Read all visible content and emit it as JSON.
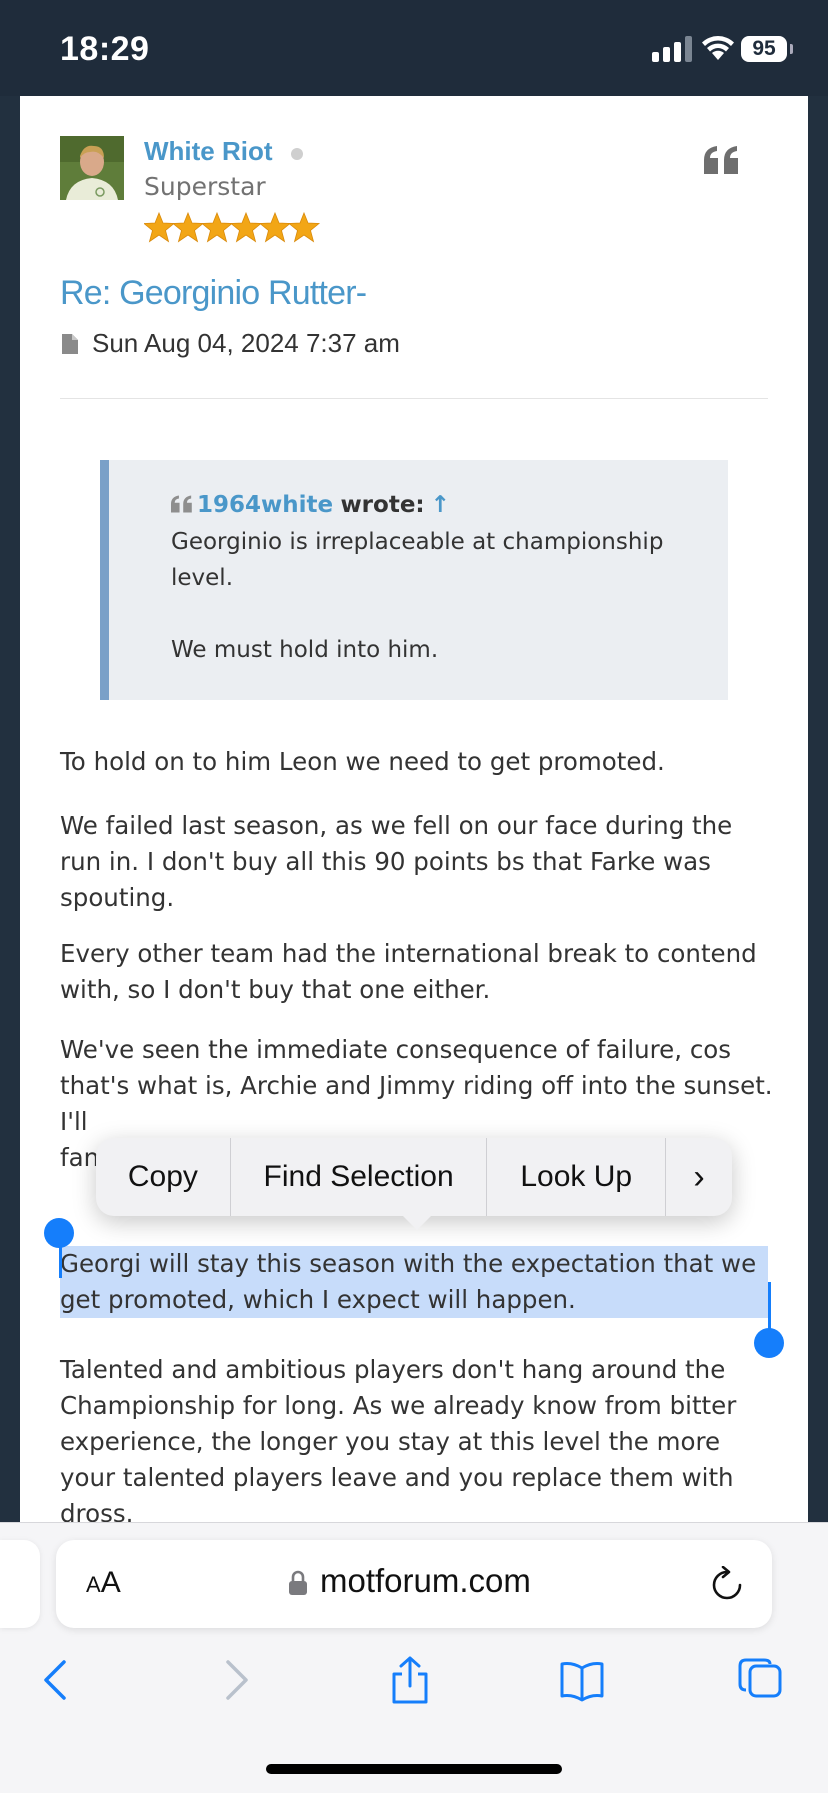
{
  "status_bar": {
    "time": "18:29",
    "battery": "95"
  },
  "post": {
    "author": "White Riot",
    "rank": "Superstar",
    "star_count": 6,
    "title": "Re: Georginio Rutter-",
    "date": "Sun Aug 04, 2024 7:37 am",
    "quote": {
      "author": "1964white",
      "wrote_label": "wrote:",
      "arrow": "↑",
      "line1": "Georginio is irreplaceable at championship level.",
      "line2": "We must hold into him."
    },
    "paragraphs": [
      "To hold on to him Leon we need to get promoted.",
      "We failed last season, as we fell on our face during the run in. I don't buy all this 90 points bs that Farke was spouting.",
      "Every other team had the international break to contend with, so I don't buy that one either.",
      "We've seen the immediate consequence of failure, cos that's what is, Archie and Jimmy riding off into the sunset. I'll",
      "fan",
      "Georgi will stay this season with the expectation that we get promoted, which I expect will happen.",
      "Talented and ambitious players don't hang around the Championship for long. As we already know from bitter experience, the longer you stay at this level the more your talented players leave and you replace them with dross."
    ]
  },
  "context_menu": {
    "copy": "Copy",
    "find_selection": "Find Selection",
    "look_up": "Look Up",
    "more": "›"
  },
  "browser": {
    "text_size_small": "A",
    "text_size_large": "A",
    "url": "motforum.com"
  },
  "colors": {
    "link": "#4a97c9",
    "selection": "#c7dcfa",
    "ios_blue": "#157efb",
    "status_bg": "#1f2c3b"
  }
}
